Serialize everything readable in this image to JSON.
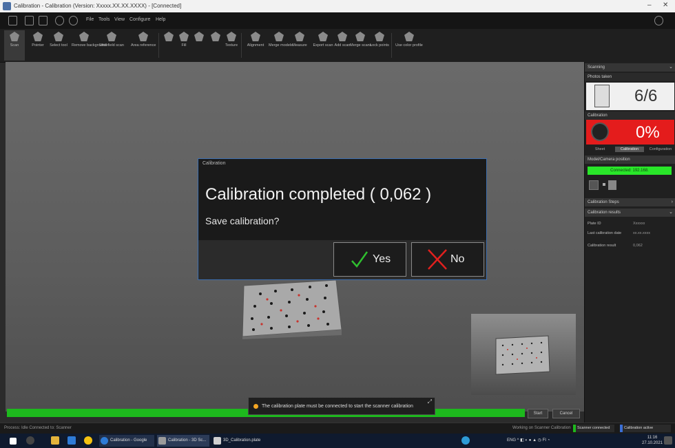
{
  "window": {
    "title": "Calibration - Calibration (Version: Xxxxx.XX.XX.XXXX) - [Connected]",
    "controls": [
      "–",
      "✕"
    ]
  },
  "menubar": {
    "items": [
      "File",
      "Tools",
      "View",
      "Configure",
      "Help"
    ]
  },
  "ribbon": {
    "buttons": [
      {
        "label": "Scan",
        "icon": "scan-icon"
      },
      {
        "label": "Pointer",
        "icon": "pointer-icon"
      },
      {
        "label": "Select tool",
        "icon": "select-icon"
      },
      {
        "label": "Remove background",
        "icon": "remove-background-icon"
      },
      {
        "label": "Widefield scan",
        "icon": "widefield-icon"
      },
      {
        "label": "Area reference",
        "icon": "area-reference-icon"
      },
      {
        "label": "",
        "icon": "tool-a-icon"
      },
      {
        "label": "",
        "icon": "tool-b-icon"
      },
      {
        "label": "Fill",
        "icon": "fill-icon"
      },
      {
        "label": "",
        "icon": "tool-c-icon"
      },
      {
        "label": "Texture",
        "icon": "texture-icon"
      },
      {
        "label": "",
        "icon": "tool-d-icon"
      },
      {
        "label": "Alignment",
        "icon": "alignment-icon"
      },
      {
        "label": "Merge models",
        "icon": "merge-icon"
      },
      {
        "label": "Measure",
        "icon": "measure-icon"
      },
      {
        "label": "Export scan",
        "icon": "export-icon"
      },
      {
        "label": "Add scan",
        "icon": "add-scan-icon"
      },
      {
        "label": "Merge scans",
        "icon": "merge-scans-icon"
      },
      {
        "label": "Lock points",
        "icon": "lock-icon"
      },
      {
        "label": "Use color profile",
        "icon": "color-profile-icon"
      }
    ],
    "group_labels": [
      "Fill",
      "Texture"
    ]
  },
  "dialog": {
    "title": "Calibration",
    "message": "Calibration completed ( 0,062 )",
    "question": "Save calibration?",
    "yes_label": "Yes",
    "no_label": "No",
    "accent": "#3d6fb0",
    "yes_color": "#2fbf2f",
    "no_color": "#e0201e"
  },
  "notice": {
    "text": "The calibration plate must be connected to start the scanner calibration"
  },
  "progress": {
    "value": 1.0,
    "color": "#1db91d"
  },
  "bottom_buttons": {
    "start": "Start",
    "cancel": "Cancel"
  },
  "status": {
    "left": "Process: Idle    Connected to: Scanner",
    "right": "Working on Scanner Calibration",
    "badge_green": "Scanner connected",
    "badge_blue": "Calibration active"
  },
  "right_panel": {
    "header": "Scanning",
    "photo_section": "Photos taken",
    "photo_count": "6/6",
    "calibration_section": "Calibration",
    "calibration_percent": "0%",
    "tabs": [
      "Sheet",
      "Calibration",
      "Configuration"
    ],
    "model_section": "Model/Camera position",
    "model_status": "Connected: 192.168.",
    "calib_state_header": "Calibration Steps",
    "calib_result_header": "Calibration results",
    "rows": [
      {
        "label": "Plate ID",
        "value": "Xxxxxx"
      },
      {
        "label": "Last calibration date",
        "value": "xx.xx.xxxx"
      },
      {
        "label": "Calibration result",
        "value": "0,062"
      }
    ]
  },
  "taskbar": {
    "apps": [
      {
        "label": "Calibration - Google",
        "color": "#2e7bd6"
      },
      {
        "label": "Calibration - 3D Sc...",
        "color": "#9b9b9b"
      },
      {
        "label": "3D_Calibration.plate",
        "color": "#cfcfcf"
      }
    ],
    "tray": "ENG  ^  ◧ ◐ ● ▲ ◷  FI  ◔",
    "time": "11:16",
    "date": "27.10.2021"
  }
}
